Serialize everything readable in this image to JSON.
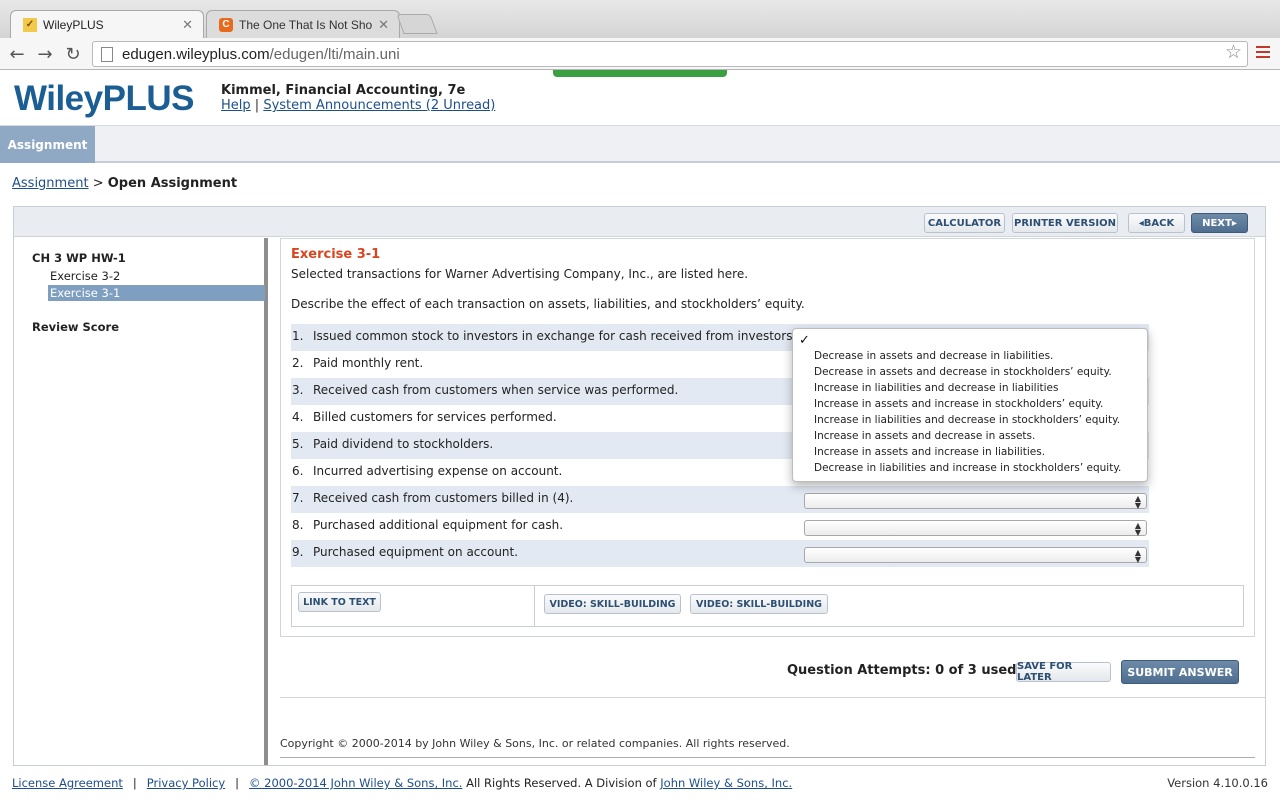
{
  "browser": {
    "tabs": [
      {
        "title": "WileyPLUS",
        "icon": "wiley-favicon"
      },
      {
        "title": "The One That Is Not Show",
        "icon": "c-favicon"
      }
    ],
    "url_host": "edugen.wileyplus.com",
    "url_path": "/edugen/lti/main.uni"
  },
  "header": {
    "logo": "WileyPLUS",
    "course": "Kimmel, Financial Accounting, 7e",
    "help": "Help",
    "sep": "|",
    "announcements": "System Announcements (2 Unread)",
    "nav_tab": "Assignment"
  },
  "breadcrumb": {
    "link": "Assignment",
    "sep": ">",
    "current": "Open Assignment"
  },
  "toolbar": {
    "calculator": "CALCULATOR",
    "printer": "PRINTER VERSION",
    "back": "BACK",
    "next": "NEXT"
  },
  "sidebar": {
    "title": "CH 3 WP HW-1",
    "items": [
      "Exercise 3-2",
      "Exercise 3-1"
    ],
    "review": "Review Score"
  },
  "exercise": {
    "title": "Exercise 3-1",
    "intro": "Selected transactions for Warner Advertising Company, Inc., are listed here.",
    "instruction": "Describe the effect of each transaction on assets, liabilities, and stockholders’ equity.",
    "questions": [
      {
        "num": "1.",
        "text": "Issued common stock to investors in exchange for cash received from investors."
      },
      {
        "num": "2.",
        "text": "Paid monthly rent."
      },
      {
        "num": "3.",
        "text": "Received cash from customers when service was performed."
      },
      {
        "num": "4.",
        "text": "Billed customers for services performed."
      },
      {
        "num": "5.",
        "text": "Paid dividend to stockholders."
      },
      {
        "num": "6.",
        "text": "Incurred advertising expense on account."
      },
      {
        "num": "7.",
        "text": "Received cash from customers billed in (4)."
      },
      {
        "num": "8.",
        "text": "Purchased additional equipment for cash."
      },
      {
        "num": "9.",
        "text": "Purchased equipment on account."
      }
    ]
  },
  "dropdown": {
    "check": "✓",
    "options": [
      "Decrease in assets and decrease in liabilities.",
      "Decrease in assets and decrease in stockholders’ equity.",
      "Increase in liabilities and decrease in liabilities",
      "Increase in assets and increase in stockholders’ equity.",
      "Increase in liabilities and decrease in stockholders’ equity.",
      "Increase in assets and decrease in assets.",
      "Increase in assets and increase in liabilities.",
      "Decrease in liabilities and increase in stockholders’ equity."
    ]
  },
  "resources": {
    "link_to_text": "LINK TO TEXT",
    "video1": "VIDEO: SKILL-BUILDING",
    "video2": "VIDEO: SKILL-BUILDING"
  },
  "attempts": "Question Attempts: 0 of 3 used",
  "actions": {
    "save": "SAVE FOR LATER",
    "submit": "SUBMIT ANSWER"
  },
  "copyright": "Copyright © 2000-2014 by John Wiley & Sons, Inc. or related companies. All rights reserved.",
  "footer": {
    "license": "License Agreement",
    "privacy": "Privacy Policy",
    "copyright_link": "© 2000-2014 John Wiley & Sons, Inc.",
    "rights": " All Rights Reserved. A Division of ",
    "division_link": "John Wiley & Sons, Inc.",
    "sep": "|",
    "version": "Version 4.10.0.16"
  },
  "colors": {
    "brand": "#1b5e93",
    "exercise_title": "#d8451f",
    "selected": "#7f9fc1",
    "row_shade": "#e3e9f3"
  }
}
